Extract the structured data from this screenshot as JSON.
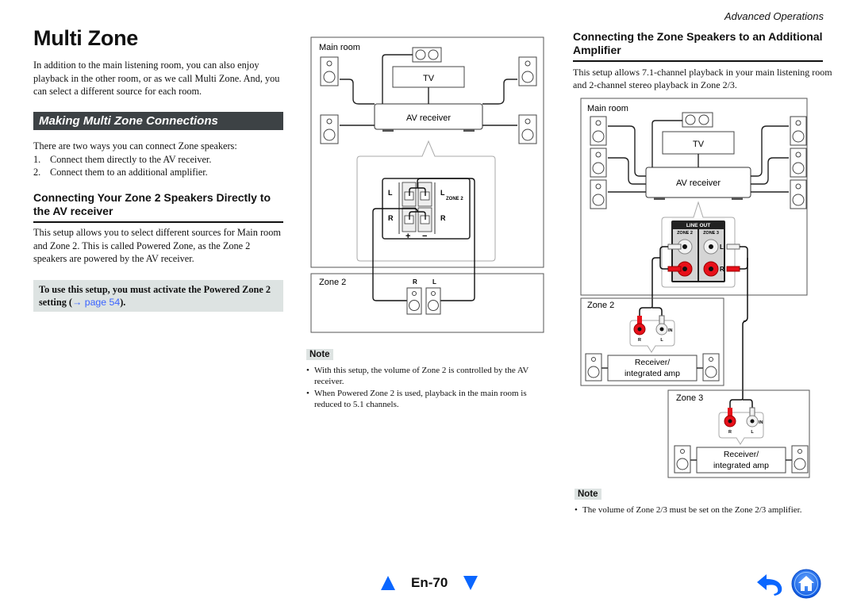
{
  "header": {
    "section": "Advanced Operations"
  },
  "page": {
    "title": "Multi Zone",
    "number": "En-70"
  },
  "left_column": {
    "intro": "In addition to the main listening room, you can also enjoy playback in the other room, or as we call Multi Zone. And, you can select a different source for each room.",
    "section_title": "Making Multi Zone Connections",
    "ways_intro": "There are two ways you can connect Zone speakers:",
    "ways": [
      {
        "num": "1.",
        "text": "Connect them directly to the AV receiver."
      },
      {
        "num": "2.",
        "text": "Connect them to an additional amplifier."
      }
    ],
    "direct_heading": "Connecting Your Zone 2 Speakers Directly to the AV receiver",
    "direct_desc": "This setup allows you to select different sources for Main room and Zone 2. This is called Powered Zone, as the Zone 2 speakers are powered by the AV receiver.",
    "powered_note": {
      "text_before": "To use this setup, you must activate the Powered Zone 2 setting (",
      "link": "→ page 54",
      "text_after": ")."
    }
  },
  "diagram1": {
    "main_room": "Main room",
    "tv": "TV",
    "av_receiver": "AV receiver",
    "terminal_L": "L",
    "terminal_R": "R",
    "zone2_tag": "ZONE 2",
    "plus": "+",
    "minus": "−",
    "zone2_label": "Zone 2",
    "speaker_R": "R",
    "speaker_L": "L"
  },
  "note1": {
    "label": "Note",
    "items": [
      "With this setup, the volume of Zone 2 is controlled by the AV receiver.",
      "When Powered Zone 2 is used, playback in the main room is reduced to 5.1 channels."
    ]
  },
  "right_column": {
    "amp_heading": "Connecting the Zone Speakers to an Additional Amplifier",
    "amp_desc": "This setup allows 7.1-channel playback in your main listening room and 2-channel stereo playback in Zone 2/3."
  },
  "diagram2": {
    "main_room": "Main room",
    "tv": "TV",
    "av_receiver": "AV receiver",
    "line_out": "LINE OUT",
    "zone2_col": "ZONE 2",
    "zone3_col": "ZONE 3",
    "L": "L",
    "R": "R",
    "zone2_label": "Zone 2",
    "zone3_label": "Zone 3",
    "in_label": "IN",
    "amp_line1": "Receiver/",
    "amp_line2": "integrated amp",
    "colors": {
      "red": "#e8101a",
      "white": "#f2f2f2"
    }
  },
  "note2": {
    "label": "Note",
    "items": [
      "The volume of Zone 2/3 must be set on the Zone 2/3 amplifier."
    ]
  },
  "nav": {
    "prev_icon": "triangle-up",
    "next_icon": "triangle-down",
    "back_icon": "back-arrow",
    "home_icon": "home",
    "accent": "#0a66ff"
  }
}
